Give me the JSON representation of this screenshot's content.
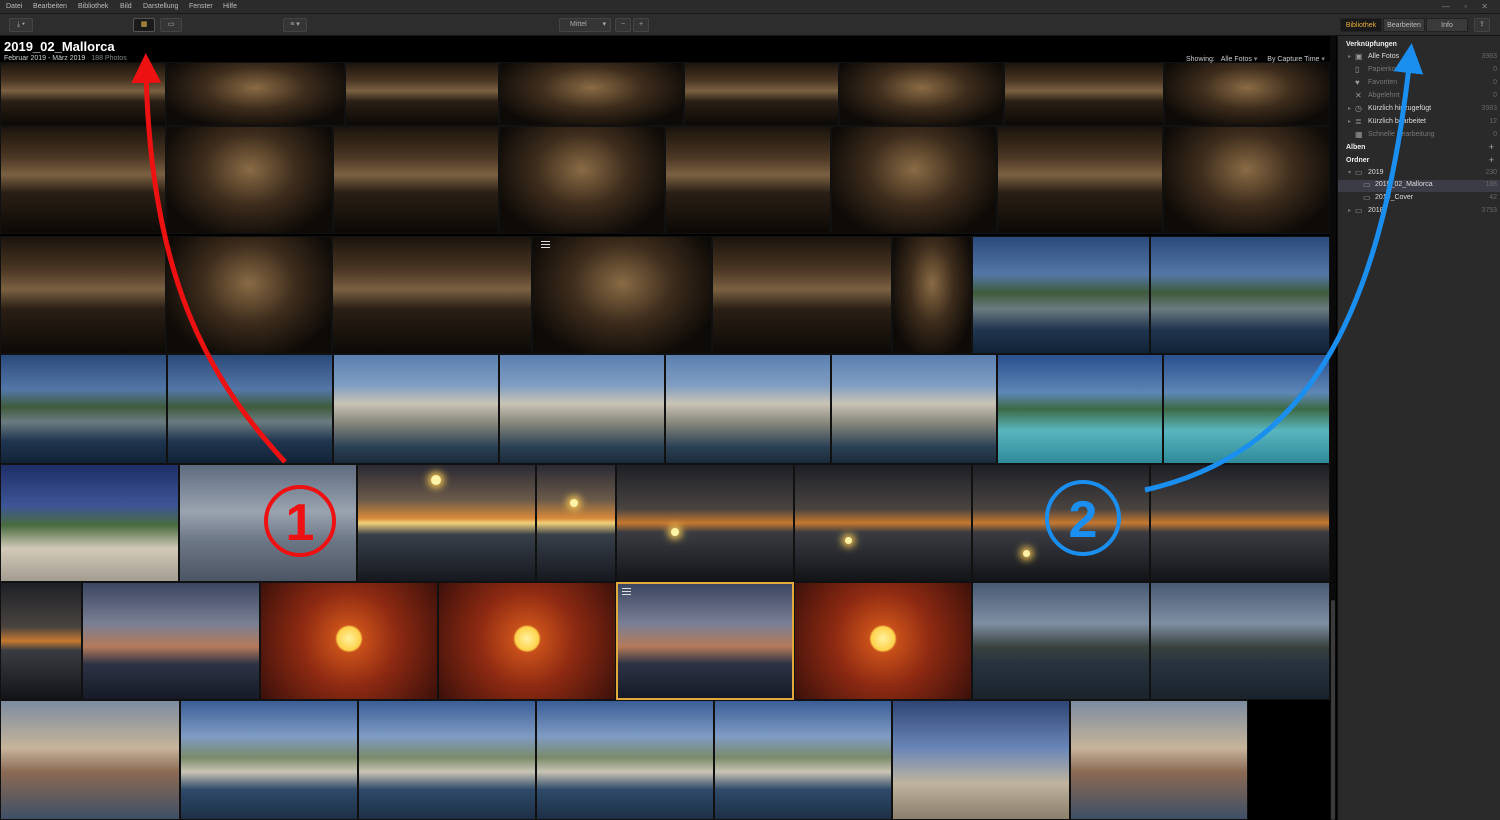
{
  "menubar": {
    "items": [
      "Datei",
      "Bearbeiten",
      "Bibliothek",
      "Bild",
      "Darstellung",
      "Fenster",
      "Hilfe"
    ],
    "window_controls": "— ▫ ✕"
  },
  "toolbar": {
    "import_icon": "download-icon",
    "view_grid_icon": "grid-view-icon",
    "view_single_icon": "single-view-icon",
    "sort_icon": "sort-icon",
    "size_value": "Mittel",
    "zoom_out": "−",
    "zoom_in": "+",
    "tabs": [
      "Bibliothek",
      "Bearbeiten",
      "Info"
    ],
    "share_icon": "share-icon"
  },
  "gallery": {
    "title": "2019_02_Mallorca",
    "subtitle": "Februar 2019 - März 2019",
    "count": "188 Photos",
    "showing_label": "Showing:",
    "showing_value": "Alle Fotos",
    "sort_value": "By Capture Time"
  },
  "sidebar": {
    "shortcuts_header": "Verknüpfungen",
    "shortcuts": [
      {
        "label": "Alle Fotos",
        "count": "3983",
        "icon": "photos-icon",
        "dim": false
      },
      {
        "label": "Papierkorb",
        "count": "0",
        "icon": "trash-icon",
        "dim": true
      },
      {
        "label": "Favoriten",
        "count": "0",
        "icon": "heart-icon",
        "dim": true
      },
      {
        "label": "Abgelehnt",
        "count": "0",
        "icon": "reject-icon",
        "dim": true
      },
      {
        "label": "Kürzlich hinzugefügt",
        "count": "3983",
        "icon": "clock-icon",
        "dim": false
      },
      {
        "label": "Kürzlich bearbeitet",
        "count": "12",
        "icon": "sliders-icon",
        "dim": false
      },
      {
        "label": "Schnelle Bearbeitung",
        "count": "0",
        "icon": "quickedit-icon",
        "dim": true
      }
    ],
    "albums_header": "Alben",
    "folders_header": "Ordner",
    "folders": [
      {
        "label": "2019",
        "count": "230",
        "indent": 0,
        "selected": false
      },
      {
        "label": "2019_02_Mallorca",
        "count": "188",
        "indent": 1,
        "selected": true
      },
      {
        "label": "2019_Cover",
        "count": "42",
        "indent": 1,
        "selected": false
      },
      {
        "label": "2018",
        "count": "3753",
        "indent": 0,
        "selected": false
      }
    ]
  },
  "annotations": {
    "one": "①",
    "two": "②",
    "red": "#ee1111",
    "blue": "#1a8ff0"
  },
  "colors": {
    "accent": "#e6ae3a",
    "selected_border": "#e2a93c"
  }
}
